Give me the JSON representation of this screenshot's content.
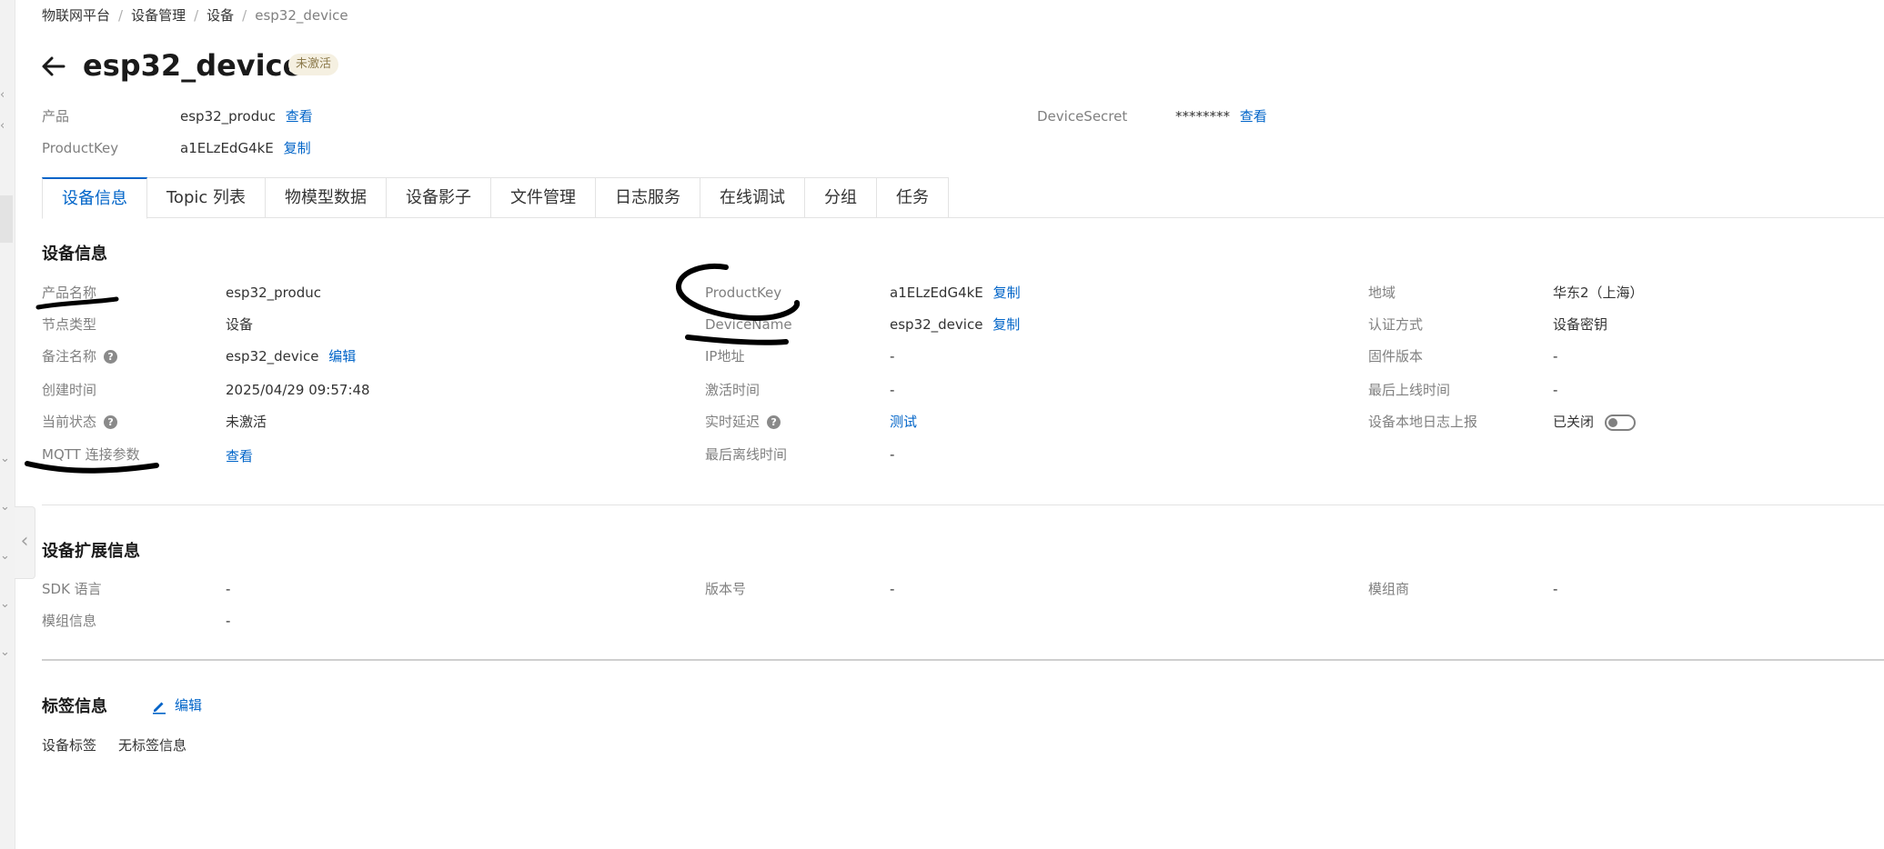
{
  "breadcrumb": [
    "物联网平台",
    "设备管理",
    "设备",
    "esp32_device"
  ],
  "header": {
    "title": "esp32_device",
    "status": "未激活"
  },
  "meta": {
    "product_label": "产品",
    "product_value": "esp32_produc",
    "product_link": "查看",
    "productkey_label": "ProductKey",
    "productkey_value": "a1ELzEdG4kE",
    "productkey_link": "复制",
    "secret_label": "DeviceSecret",
    "secret_value": "********",
    "secret_link": "查看"
  },
  "tabs": [
    "设备信息",
    "Topic 列表",
    "物模型数据",
    "设备影子",
    "文件管理",
    "日志服务",
    "在线调试",
    "分组",
    "任务"
  ],
  "device_info": {
    "title": "设备信息",
    "product_name": {
      "label": "产品名称",
      "value": "esp32_produc"
    },
    "node_type": {
      "label": "节点类型",
      "value": "设备"
    },
    "remark_name": {
      "label": "备注名称",
      "value": "esp32_device",
      "link": "编辑"
    },
    "created_at": {
      "label": "创建时间",
      "value": "2025/04/29 09:57:48"
    },
    "current_status": {
      "label": "当前状态",
      "value": "未激活"
    },
    "mqtt": {
      "label": "MQTT 连接参数",
      "link": "查看"
    },
    "productkey": {
      "label": "ProductKey",
      "value": "a1ELzEdG4kE",
      "link": "复制"
    },
    "devicename": {
      "label": "DeviceName",
      "value": "esp32_device",
      "link": "复制"
    },
    "ip": {
      "label": "IP地址",
      "value": "-"
    },
    "activated_at": {
      "label": "激活时间",
      "value": "-"
    },
    "latency": {
      "label": "实时延迟",
      "link": "测试"
    },
    "last_offline": {
      "label": "最后离线时间",
      "value": "-"
    },
    "region": {
      "label": "地域",
      "value": "华东2（上海）"
    },
    "auth": {
      "label": "认证方式",
      "value": "设备密钥"
    },
    "firmware": {
      "label": "固件版本",
      "value": "-"
    },
    "last_online": {
      "label": "最后上线时间",
      "value": "-"
    },
    "local_log": {
      "label": "设备本地日志上报",
      "value": "已关闭"
    }
  },
  "ext_info": {
    "title": "设备扩展信息",
    "sdk": {
      "label": "SDK 语言",
      "value": "-"
    },
    "version": {
      "label": "版本号",
      "value": "-"
    },
    "module_vendor": {
      "label": "模组商",
      "value": "-"
    },
    "module_info": {
      "label": "模组信息",
      "value": "-"
    }
  },
  "tags": {
    "title": "标签信息",
    "edit": "编辑",
    "label": "设备标签",
    "value": "无标签信息"
  },
  "colors": {
    "link": "#0064c8",
    "label": "#808080",
    "text": "#333333",
    "badge_bg": "#f5f0e1"
  },
  "icons": [
    "back-arrow-icon",
    "help-icon",
    "pencil-icon",
    "chevron-left-icon"
  ]
}
